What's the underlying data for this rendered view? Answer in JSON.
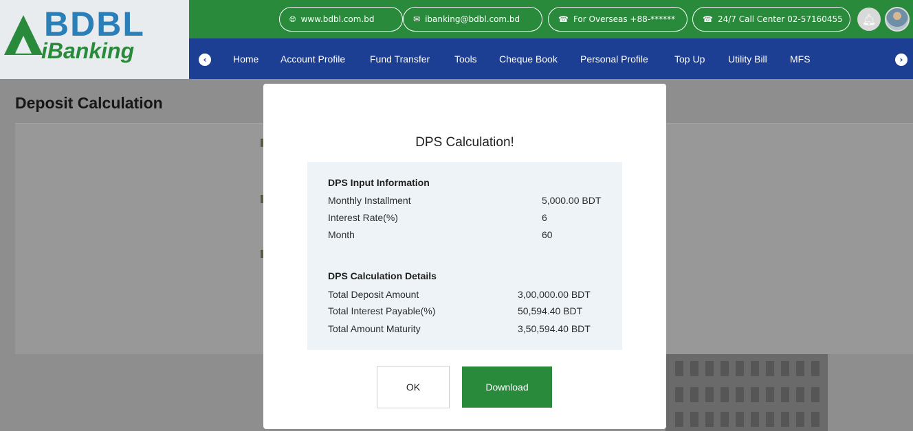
{
  "brand": {
    "name": "BDBL",
    "sub": "iBanking"
  },
  "topbar": {
    "links": [
      {
        "icon": "globe-icon",
        "label": "www.bdbl.com.bd"
      },
      {
        "icon": "mail-icon",
        "label": "ibanking@bdbl.com.bd"
      },
      {
        "icon": "phone-icon",
        "label": "For Overseas +88-******"
      },
      {
        "icon": "phone-icon",
        "label": "24/7 Call Center 02-57160455"
      }
    ]
  },
  "nav": {
    "items": [
      "Home",
      "Account Profile",
      "Fund Transfer",
      "Tools",
      "Cheque Book",
      "Personal Profile",
      "Top Up",
      "Utility Bill",
      "MFS"
    ]
  },
  "page": {
    "title": "Deposit Calculation"
  },
  "modal": {
    "title": "DPS Calculation!",
    "input_section": {
      "heading": "DPS Input Information",
      "rows": [
        {
          "label": "Monthly Installment",
          "value": "5,000.00 BDT"
        },
        {
          "label": "Interest Rate(%)",
          "value": "6"
        },
        {
          "label": "Month",
          "value": "60"
        }
      ]
    },
    "calc_section": {
      "heading": "DPS Calculation Details",
      "rows": [
        {
          "label": "Total Deposit Amount",
          "value": "3,00,000.00 BDT"
        },
        {
          "label": "Total Interest Payable(%)",
          "value": "50,594.40 BDT"
        },
        {
          "label": "Total Amount Maturity",
          "value": "3,50,594.40 BDT"
        }
      ]
    },
    "ok_label": "OK",
    "download_label": "Download"
  },
  "colors": {
    "green": "#2a8a3c",
    "navy": "#1c3f94",
    "logo_blue": "#2a7fb8"
  }
}
